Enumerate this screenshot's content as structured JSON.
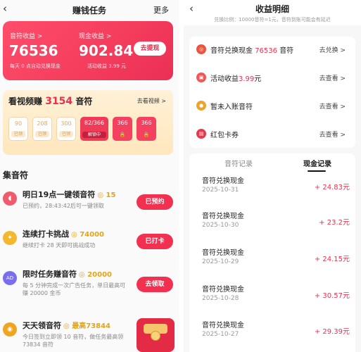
{
  "left": {
    "header": {
      "back": "‹",
      "title": "赚钱任务",
      "more": "更多"
    },
    "balance": {
      "coin_label": "音符收益 >",
      "coin_value": "76536",
      "coin_note": "每天 0 点自动兑换现金",
      "cash_label": "现金收益 >",
      "cash_value": "902.84",
      "cash_note": "活动收益 3.99 元",
      "withdraw": "去提现"
    },
    "video": {
      "title_prefix": "看视频赚",
      "title_num": "3154",
      "title_suffix": "音符",
      "link": "去看视频 >",
      "tiles": [
        {
          "value": "90",
          "label": "已领",
          "state": "done"
        },
        {
          "value": "208",
          "label": "已领",
          "state": "done"
        },
        {
          "value": "300",
          "label": "已领",
          "state": "done"
        },
        {
          "value": "82/366",
          "label": "解锁中",
          "state": "active"
        },
        {
          "value": "366",
          "label": "🔒",
          "state": "locked"
        },
        {
          "value": "366",
          "label": "🔒",
          "state": "locked"
        }
      ]
    },
    "section_title": "集音符",
    "tasks": [
      {
        "icon": "piggy-bank-icon",
        "icon_char": "◖",
        "icon_color": "#f05c6e",
        "title": "明日19点一键领音符",
        "coin": "◎ 15",
        "desc": "已预约，28:43:42后可一键领取",
        "button": "已预约"
      },
      {
        "icon": "streak-icon",
        "icon_char": "✦",
        "icon_color": "#f3b830",
        "title": "连续打卡挑战",
        "coin": "◎ 74000",
        "desc": "继续打卡 28 天即可挑战成功",
        "button": "已打卡"
      },
      {
        "icon": "ad-icon",
        "icon_char": "AD",
        "icon_color": "#7a6ef0",
        "title": "限时任务赚音符",
        "coin": "◎ 20000",
        "desc": "每 5 分钟完成一次广告任务，单日最高可赚 20000 金币",
        "button": "去领取"
      },
      {
        "icon": "coin-icon",
        "icon_char": "◉",
        "icon_color": "#f0a520",
        "title": "天天领音符",
        "coin": "◎ 最高73844",
        "desc": "今日签到立即领 10 音符，做任务最高领 73834 音符",
        "button": ""
      }
    ]
  },
  "right": {
    "header": {
      "back": "‹",
      "title": "收益明细",
      "note": "兑换比例：10000音符=1元，音符到账可能会有延迟"
    },
    "rows": [
      {
        "icon": "coin-exchange-icon",
        "icon_char": "◎",
        "icon_color": "#f0523e",
        "label": "音符兑换现金",
        "highlight": "76536",
        "suffix": "音符",
        "action": "去兑换 >"
      },
      {
        "icon": "gift-icon",
        "icon_char": "▣",
        "icon_color": "#f25656",
        "label": "活动收益",
        "highlight": "3.99",
        "suffix": "元",
        "action": "去查看 >"
      },
      {
        "icon": "pending-coin-icon",
        "icon_char": "●",
        "icon_color": "#f0a22e",
        "label": "暂未入账音符",
        "highlight": "",
        "suffix": "",
        "action": "去查看 >"
      },
      {
        "icon": "red-envelope-icon",
        "icon_char": "▤",
        "icon_color": "#e8384b",
        "label": "红包卡券",
        "highlight": "",
        "suffix": "",
        "action": "去查看 >"
      }
    ],
    "tabs": [
      "音符记录",
      "现金记录"
    ],
    "records": [
      {
        "title": "音符兑换现金",
        "date": "2025-10-31",
        "amount": "+ 24.83元"
      },
      {
        "title": "音符兑换现金",
        "date": "2025-10-30",
        "amount": "+ 23.2元"
      },
      {
        "title": "音符兑换现金",
        "date": "2025-10-29",
        "amount": "+ 24.15元"
      },
      {
        "title": "音符兑换现金",
        "date": "2025-10-28",
        "amount": "+ 30.57元"
      },
      {
        "title": "音符兑换现金",
        "date": "2025-10-27",
        "amount": "+ 29.39元"
      }
    ]
  }
}
